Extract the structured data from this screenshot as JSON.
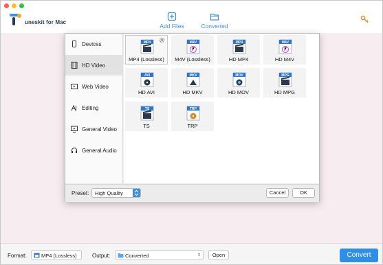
{
  "app": {
    "name": "TunesKit for Mac",
    "logo_text": "uneskit for Mac"
  },
  "toolbar": {
    "add_files": "Add Files",
    "converted": "Converted",
    "accent": "#3d8fe0"
  },
  "sidebar": {
    "items": [
      {
        "label": "Devices",
        "icon": "phone-icon"
      },
      {
        "label": "HD Video",
        "icon": "film-icon"
      },
      {
        "label": "Web Video",
        "icon": "web-video-icon"
      },
      {
        "label": "Editing",
        "icon": "editing-icon"
      },
      {
        "label": "General Video",
        "icon": "monitor-icon"
      },
      {
        "label": "General Audio",
        "icon": "headphones-icon"
      }
    ],
    "active": "HD Video"
  },
  "formats": [
    {
      "badge": "MP4",
      "label": "MP4 (Lossless)",
      "selected": true,
      "badge_color": "#2a78d2",
      "emblem": "clapper"
    },
    {
      "badge": "M4V",
      "label": "M4V (Lossless)",
      "selected": false,
      "badge_color": "#2a78d2",
      "emblem": "music"
    },
    {
      "badge": "MP4",
      "label": "HD MP4",
      "selected": false,
      "badge_color": "#2a78d2",
      "emblem": "clapper"
    },
    {
      "badge": "M4V",
      "label": "HD M4V",
      "selected": false,
      "badge_color": "#2a78d2",
      "emblem": "music"
    },
    {
      "badge": "AVI",
      "label": "HD AVI",
      "selected": false,
      "badge_color": "#2a78d2",
      "emblem": "disc"
    },
    {
      "badge": "MKV",
      "label": "HD MKV",
      "selected": false,
      "badge_color": "#2a78d2",
      "emblem": "mkv"
    },
    {
      "badge": "MOV",
      "label": "HD MOV",
      "selected": false,
      "badge_color": "#2a78d2",
      "emblem": "quicktime"
    },
    {
      "badge": "MPG",
      "label": "HD MPG",
      "selected": false,
      "badge_color": "#2a78d2",
      "emblem": "clapper"
    },
    {
      "badge": "TS",
      "label": "TS",
      "selected": false,
      "badge_color": "#2a78d2",
      "emblem": "clapper"
    },
    {
      "badge": "TRP",
      "label": "TRP",
      "selected": false,
      "badge_color": "#2a78d2",
      "emblem": "reel"
    }
  ],
  "dialog_footer": {
    "preset_label": "Preset:",
    "preset_value": "High Quality",
    "cancel": "Cancel",
    "ok": "OK"
  },
  "bottom": {
    "format_label": "Format:",
    "format_value": "MP4 (Lossless)",
    "output_label": "Output:",
    "output_value": "Converted",
    "open": "Open",
    "convert": "Convert",
    "convert_color": "#2f8ee5"
  }
}
